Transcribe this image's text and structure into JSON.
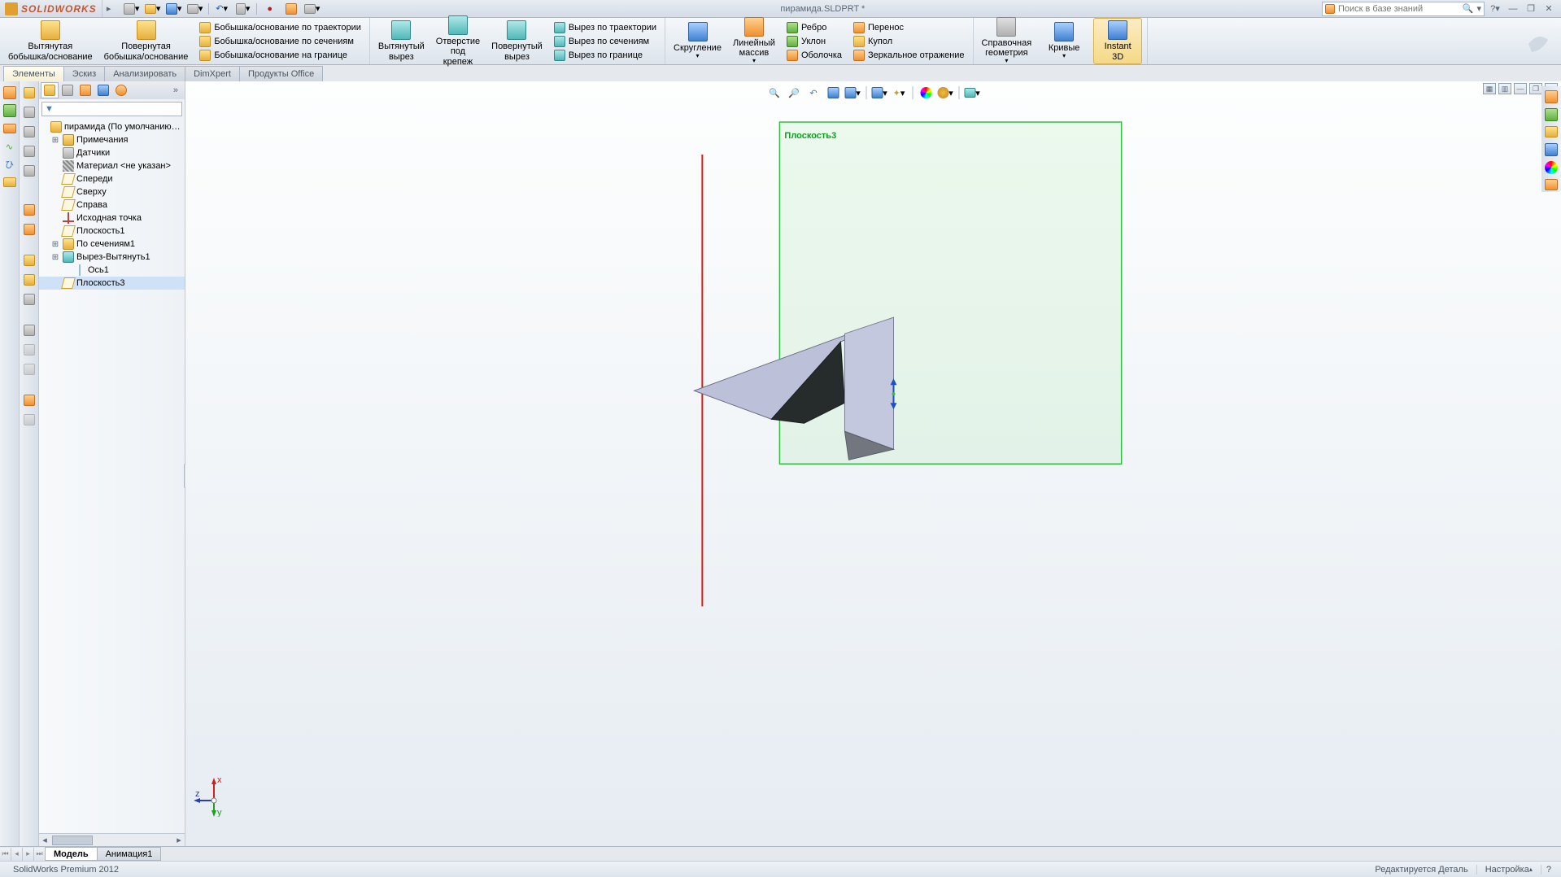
{
  "app": {
    "name": "SOLIDWORKS",
    "doc_title": "пирамида.SLDPRT *",
    "search_placeholder": "Поиск в базе знаний"
  },
  "ribbon": {
    "extruded_boss": "Вытянутая\nбобышка/основание",
    "revolved_boss": "Повернутая\nбобышка/основание",
    "swept_boss": "Бобышка/основание по траектории",
    "lofted_boss": "Бобышка/основание по сечениям",
    "boundary_boss": "Бобышка/основание на границе",
    "extruded_cut": "Вытянутый\nвырез",
    "hole": "Отверстие\nпод\nкрепеж",
    "revolved_cut": "Повернутый\nвырез",
    "swept_cut": "Вырез по траектории",
    "lofted_cut": "Вырез по сечениям",
    "boundary_cut": "Вырез по границе",
    "fillet": "Скругление",
    "linear_pattern": "Линейный\nмассив",
    "rib": "Ребро",
    "draft": "Уклон",
    "shell": "Оболочка",
    "wrap": "Перенос",
    "dome": "Купол",
    "mirror": "Зеркальное отражение",
    "ref_geom": "Справочная\nгеометрия",
    "curves": "Кривые",
    "instant3d": "Instant\n3D"
  },
  "tabs": {
    "t1": "Элементы",
    "t2": "Эскиз",
    "t3": "Анализировать",
    "t4": "DimXpert",
    "t5": "Продукты Office"
  },
  "tree": {
    "root": "пирамида  (По умолчанию<<По умол...",
    "annotations": "Примечания",
    "sensors": "Датчики",
    "material": "Материал <не указан>",
    "front": "Спереди",
    "top": "Сверху",
    "right": "Справа",
    "origin": "Исходная точка",
    "plane1": "Плоскость1",
    "loft1": "По сечениям1",
    "cut1": "Вырез-Вытянуть1",
    "axis1": "Ось1",
    "plane3": "Плоскость3"
  },
  "viewport": {
    "plane_label": "Плоскость3"
  },
  "bottom_tabs": {
    "model": "Модель",
    "anim": "Анимация1"
  },
  "status": {
    "product": "SolidWorks Premium 2012",
    "editing": "Редактируется Деталь",
    "custom": "Настройка"
  },
  "triad": {
    "x": "x",
    "y": "y",
    "z": "z"
  }
}
